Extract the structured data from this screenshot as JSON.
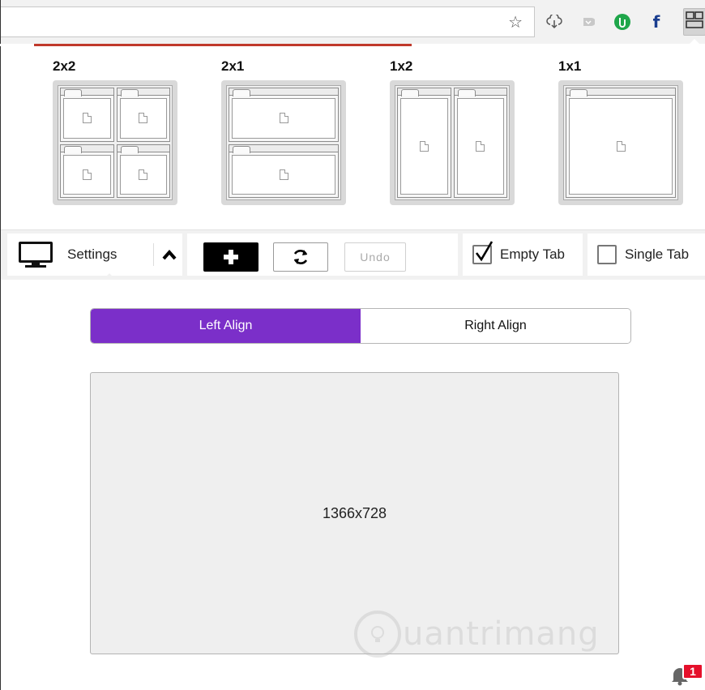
{
  "browser": {
    "extensions": [
      "star-icon",
      "cloud-download-icon",
      "pocket-icon",
      "evernote-icon",
      "facebook-icon",
      "tab-resize-icon"
    ],
    "accent_progress": "#c0392b"
  },
  "layouts": [
    {
      "title": "2x2"
    },
    {
      "title": "2x1"
    },
    {
      "title": "1x2"
    },
    {
      "title": "1x1"
    }
  ],
  "controls": {
    "settings_label": "Settings",
    "undo_label": "Undo",
    "empty_tab_label": "Empty Tab",
    "empty_tab_checked": true,
    "single_tab_label": "Single Tab",
    "single_tab_checked": false
  },
  "align": {
    "left_label": "Left Align",
    "right_label": "Right Align",
    "selected": "left",
    "accent": "#7b2fc9"
  },
  "screen": {
    "resolution": "1366x728"
  },
  "notifications": {
    "count": "1",
    "badge_color": "#e5102b"
  },
  "watermark": {
    "text": "uantrimang"
  }
}
